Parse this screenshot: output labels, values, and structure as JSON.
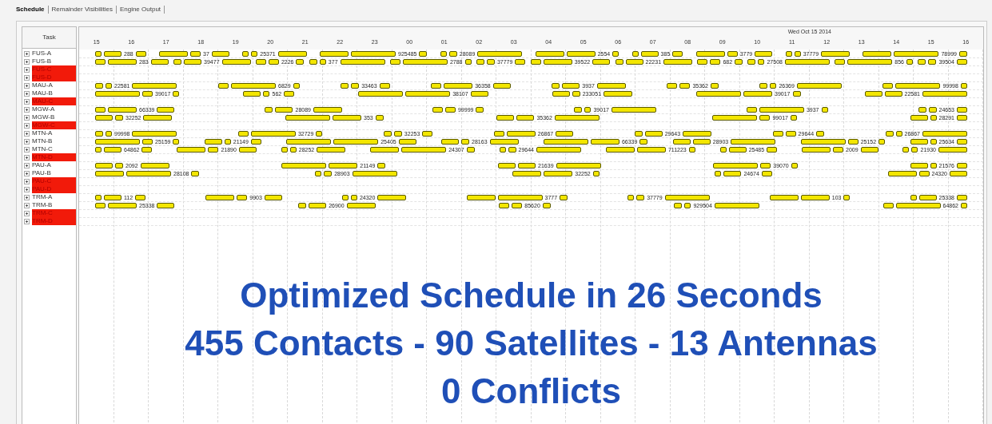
{
  "tabs": [
    {
      "label": "Schedule",
      "selected": true
    },
    {
      "label": "Remainder Visibilities",
      "selected": false
    },
    {
      "label": "Engine Output",
      "selected": false
    }
  ],
  "task_list": {
    "header": "Task"
  },
  "timeline": {
    "date": "Wed Oct 15 2014",
    "hours": [
      "15",
      "16",
      "17",
      "18",
      "19",
      "20",
      "21",
      "22",
      "23",
      "00",
      "01",
      "02",
      "03",
      "04",
      "05",
      "06",
      "07",
      "08",
      "09",
      "10",
      "11",
      "12",
      "13",
      "14",
      "15",
      "16"
    ]
  },
  "tasks": [
    {
      "name": "FUS-A",
      "highlighted": false,
      "labels": [
        "288",
        "37",
        "25371",
        "925485",
        "28089",
        "2554",
        "385",
        "3779",
        "37779",
        "78999"
      ]
    },
    {
      "name": "FUS-B",
      "highlighted": false,
      "labels": [
        "283",
        "39477",
        "2226",
        "377",
        "2788",
        "37779",
        "39522",
        "22231",
        "682",
        "27508",
        "856",
        "39504"
      ]
    },
    {
      "name": "FUS-C",
      "highlighted": true
    },
    {
      "name": "FUS-D",
      "highlighted": true
    },
    {
      "name": "MAU-A",
      "highlighted": false,
      "labels": [
        "22581",
        "6829",
        "33463",
        "36358",
        "3937",
        "35362",
        "26369",
        "99998"
      ]
    },
    {
      "name": "MAU-B",
      "highlighted": false,
      "labels": [
        "39017",
        "562",
        "38107",
        "233051",
        "39017",
        "22581"
      ]
    },
    {
      "name": "MAU-C",
      "highlighted": true
    },
    {
      "name": "MGW-A",
      "highlighted": false,
      "labels": [
        "66339",
        "28089",
        "99999",
        "39017",
        "3937",
        "24653"
      ]
    },
    {
      "name": "MGW-B",
      "highlighted": false,
      "labels": [
        "32252",
        "353",
        "35362",
        "99017",
        "28291"
      ]
    },
    {
      "name": "MGW-C",
      "highlighted": true
    },
    {
      "name": "MTN-A",
      "highlighted": false,
      "labels": [
        "99998",
        "32729",
        "32253",
        "26867",
        "29643",
        "29644",
        "26867"
      ]
    },
    {
      "name": "MTN-B",
      "highlighted": false,
      "labels": [
        "25159",
        "21149",
        "25405",
        "28163",
        "66339",
        "28903",
        "25152",
        "25634"
      ]
    },
    {
      "name": "MTN-C",
      "highlighted": false,
      "labels": [
        "64862",
        "21890",
        "28252",
        "24307",
        "29644",
        "711223",
        "25485",
        "2009",
        "21930"
      ]
    },
    {
      "name": "MTN-D",
      "highlighted": true
    },
    {
      "name": "PAU-A",
      "highlighted": false,
      "labels": [
        "2092",
        "21149",
        "21639",
        "39070",
        "21576"
      ]
    },
    {
      "name": "PAU-B",
      "highlighted": false,
      "labels": [
        "28108",
        "28903",
        "32252",
        "24674",
        "24320"
      ]
    },
    {
      "name": "PAU-C",
      "highlighted": true
    },
    {
      "name": "PAU-D",
      "highlighted": true
    },
    {
      "name": "TRM-A",
      "highlighted": false,
      "labels": [
        "112",
        "9903",
        "24320",
        "3777",
        "37779",
        "103",
        "25338"
      ]
    },
    {
      "name": "TRM-B",
      "highlighted": false,
      "labels": [
        "25338",
        "26900",
        "85620",
        "929504",
        "64862"
      ]
    },
    {
      "name": "TRM-C",
      "highlighted": true
    },
    {
      "name": "TRM-D",
      "highlighted": true
    }
  ],
  "summary": [
    "Optimized Schedule in 26 Seconds",
    "455 Contacts - 90 Satellites - 13 Antennas",
    "0 Conflicts"
  ]
}
